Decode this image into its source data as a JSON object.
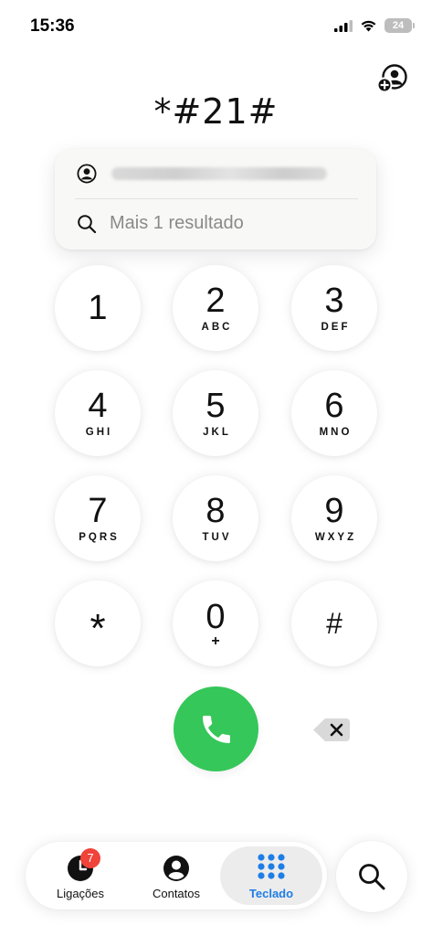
{
  "status_bar": {
    "time": "15:36",
    "battery_level": "24",
    "icons": [
      "cellular-signal-icon",
      "wifi-icon",
      "battery-icon"
    ]
  },
  "dialer": {
    "dialed_number": "*#21#"
  },
  "suggestions": {
    "more_results_label": "Mais 1 resultado",
    "contact_icon": "person-circle-icon",
    "search_icon": "magnifier-icon"
  },
  "keypad": {
    "keys": [
      {
        "digit": "1",
        "letters": ""
      },
      {
        "digit": "2",
        "letters": "ABC"
      },
      {
        "digit": "3",
        "letters": "DEF"
      },
      {
        "digit": "4",
        "letters": "GHI"
      },
      {
        "digit": "5",
        "letters": "JKL"
      },
      {
        "digit": "6",
        "letters": "MNO"
      },
      {
        "digit": "7",
        "letters": "PQRS"
      },
      {
        "digit": "8",
        "letters": "TUV"
      },
      {
        "digit": "9",
        "letters": "WXYZ"
      },
      {
        "digit": "*",
        "letters": ""
      },
      {
        "digit": "0",
        "letters": "+"
      },
      {
        "digit": "#",
        "letters": ""
      }
    ]
  },
  "actions": {
    "call_icon": "phone-handset-icon",
    "delete_icon": "delete-backspace-icon",
    "add_contact_icon": "add-contact-icon",
    "call_color": "#35c759"
  },
  "tabbar": {
    "tabs": [
      {
        "label": "Ligações",
        "icon": "clock-icon",
        "badge": "7",
        "active": false
      },
      {
        "label": "Contatos",
        "icon": "person-circle-icon",
        "active": false
      },
      {
        "label": "Teclado",
        "icon": "keypad-grid-icon",
        "active": true
      }
    ],
    "search_icon": "magnifier-icon",
    "active_color": "#1e7de6",
    "badge_color": "#f0433a"
  }
}
